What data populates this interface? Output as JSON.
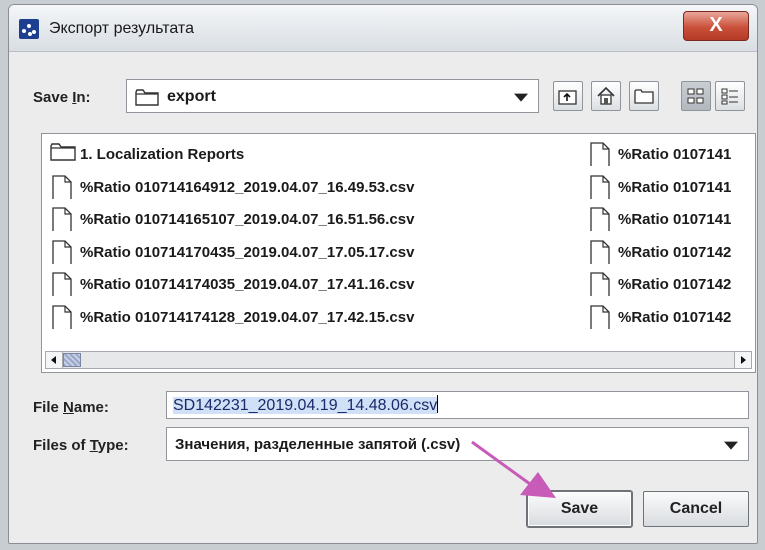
{
  "window": {
    "title": "Экспорт результата",
    "close_glyph": "X"
  },
  "save_in": {
    "label_pre": "Save ",
    "label_key": "I",
    "label_post": "n:",
    "value": "export"
  },
  "toolbar": {
    "icons": [
      "up-folder-icon",
      "home-icon",
      "new-folder-icon",
      "list-view-icon",
      "details-view-icon"
    ]
  },
  "files": {
    "left": [
      {
        "name": "1. Localization Reports",
        "type": "folder"
      },
      {
        "name": "%Ratio 010714164912_2019.04.07_16.49.53.csv",
        "type": "file"
      },
      {
        "name": "%Ratio 010714165107_2019.04.07_16.51.56.csv",
        "type": "file"
      },
      {
        "name": "%Ratio 010714170435_2019.04.07_17.05.17.csv",
        "type": "file"
      },
      {
        "name": "%Ratio 010714174035_2019.04.07_17.41.16.csv",
        "type": "file"
      },
      {
        "name": "%Ratio 010714174128_2019.04.07_17.42.15.csv",
        "type": "file"
      }
    ],
    "right": [
      {
        "name": "%Ratio 0107141",
        "type": "file"
      },
      {
        "name": "%Ratio 0107141",
        "type": "file"
      },
      {
        "name": "%Ratio 0107141",
        "type": "file"
      },
      {
        "name": "%Ratio 0107142",
        "type": "file"
      },
      {
        "name": "%Ratio 0107142",
        "type": "file"
      },
      {
        "name": "%Ratio 0107142",
        "type": "file"
      }
    ]
  },
  "file_name": {
    "label_pre": "File ",
    "label_key": "N",
    "label_post": "ame:",
    "value": "SD142231_2019.04.19_14.48.06.csv"
  },
  "file_type": {
    "label_pre": "Files of ",
    "label_key": "T",
    "label_post": "ype:",
    "value": "Значения, разделенные запятой (.csv)"
  },
  "buttons": {
    "save": "Save",
    "cancel": "Cancel"
  },
  "colors": {
    "annotation_arrow": "#c85bb8",
    "app_icon": "#1d3f8f"
  }
}
